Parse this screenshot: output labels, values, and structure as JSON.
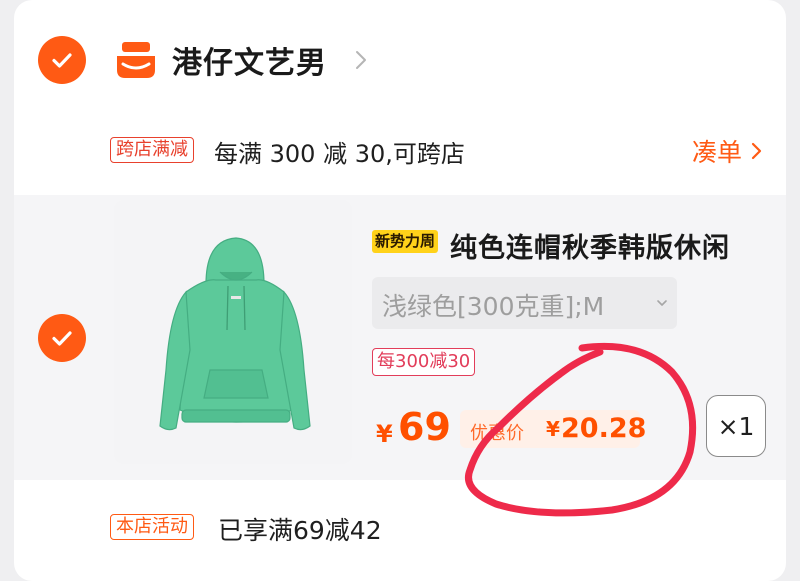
{
  "shop": {
    "name": "港仔文艺男",
    "checked": true
  },
  "promo": {
    "tag": "跨店满减",
    "text": "每满 300 减 30,可跨店",
    "action": "凑单"
  },
  "item": {
    "checked": true,
    "badge": "新势力周",
    "title": "纯色连帽秋季韩版休闲",
    "sku": "浅绿色[300克重];M",
    "promo_tag": "每300减30",
    "price_symbol": "¥",
    "price": "69",
    "discount_label": "优惠价",
    "discount_symbol": "¥",
    "discount_price": "20.28",
    "quantity": "×1",
    "hoodie_color": "#5cc99a"
  },
  "activity": {
    "tag": "本店活动",
    "text": "已享满69减42"
  },
  "colors": {
    "accent": "#ff5a14",
    "price": "#ff5000",
    "annotation": "#ee2a4a"
  }
}
